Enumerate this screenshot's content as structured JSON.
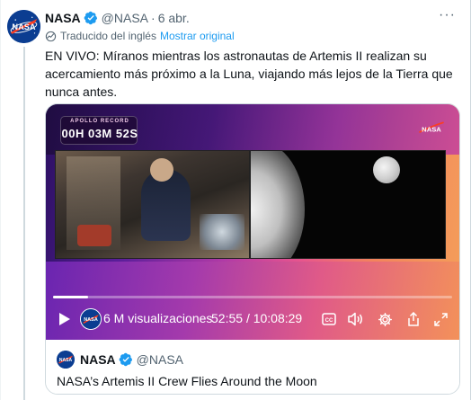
{
  "tweet": {
    "author_name": "NASA",
    "author_handle": "@NASA",
    "separator": "·",
    "date": "6 abr.",
    "more_label": "···",
    "translated_label": "Traducido del inglés",
    "show_original": "Mostrar original",
    "text": "EN VIVO: Míranos mientras los astronautas de Artemis II realizan su acercamiento más próximo a la Luna, viajando más lejos de la Tierra que nunca antes."
  },
  "video": {
    "overlay_label": "APOLLO RECORD",
    "overlay_timer": "00H 03M 52S",
    "views": "6 M visualizaciones",
    "elapsed": "52:55",
    "timecode_sep": "/",
    "duration": "10:08:29",
    "progress_fraction": 0.087
  },
  "quoted": {
    "author_name": "NASA",
    "author_handle": "@NASA",
    "text": "NASA’s Artemis II Crew Flies Around the Moon"
  },
  "colors": {
    "accent_blue": "#1d9bf0",
    "nasa_blue": "#0b3d91",
    "nasa_red": "#fc3d21",
    "verified_blue": "#1d9bf0"
  },
  "icons": {
    "verified": "verified-badge-icon",
    "translate": "globe-icon",
    "play": "play-icon",
    "captions": "captions-icon",
    "volume": "volume-icon",
    "settings": "gear-icon",
    "share": "share-icon",
    "fullscreen": "fullscreen-icon",
    "more": "more-icon"
  }
}
